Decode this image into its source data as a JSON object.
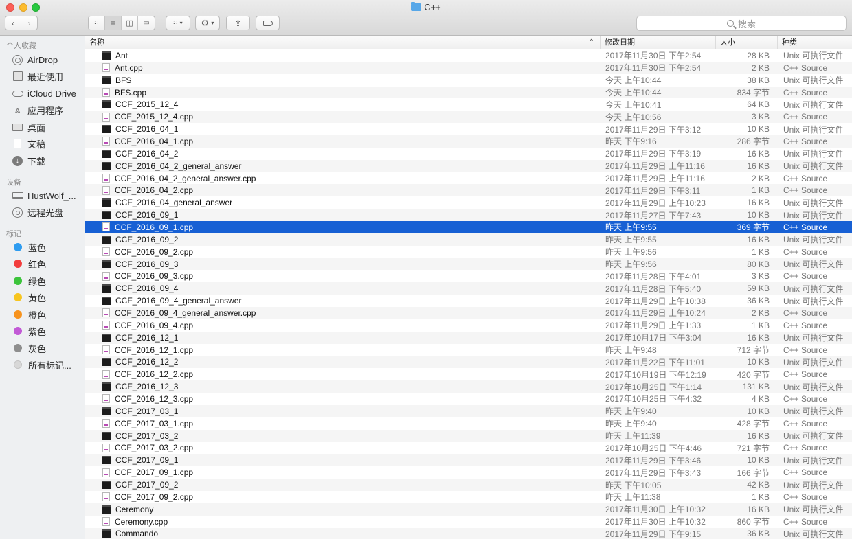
{
  "window": {
    "title": "C++"
  },
  "toolbar": {
    "search_placeholder": "搜索"
  },
  "sidebar": {
    "favorites_heading": "个人收藏",
    "favorites": [
      {
        "label": "AirDrop",
        "icon": "airdrop-icon"
      },
      {
        "label": "最近使用",
        "icon": "recents-icon"
      },
      {
        "label": "iCloud Drive",
        "icon": "cloud-icon"
      },
      {
        "label": "应用程序",
        "icon": "applications-icon"
      },
      {
        "label": "桌面",
        "icon": "desktop-icon"
      },
      {
        "label": "文稿",
        "icon": "documents-icon"
      },
      {
        "label": "下载",
        "icon": "downloads-icon"
      }
    ],
    "devices_heading": "设备",
    "devices": [
      {
        "label": "HustWolf_...",
        "icon": "laptop-icon"
      },
      {
        "label": "远程光盘",
        "icon": "disc-icon"
      }
    ],
    "tags_heading": "标记",
    "tags": [
      {
        "label": "蓝色",
        "color": "#2e9cf0"
      },
      {
        "label": "红色",
        "color": "#f23d3d"
      },
      {
        "label": "绿色",
        "color": "#3cc43c"
      },
      {
        "label": "黄色",
        "color": "#f7c520"
      },
      {
        "label": "橙色",
        "color": "#f7931e"
      },
      {
        "label": "紫色",
        "color": "#c25ad6"
      },
      {
        "label": "灰色",
        "color": "#8e8e8e"
      },
      {
        "label": "所有标记...",
        "color": "#d8d8d8"
      }
    ]
  },
  "columns": {
    "name": "名称",
    "date": "修改日期",
    "size": "大小",
    "kind": "种类"
  },
  "colors": {
    "selection": "#1760d4"
  },
  "files": [
    {
      "name": "Ant",
      "date": "2017年11月30日 下午2:54",
      "size": "28 KB",
      "kind": "Unix 可执行文件",
      "type": "exec"
    },
    {
      "name": "Ant.cpp",
      "date": "2017年11月30日 下午2:54",
      "size": "2 KB",
      "kind": "C++ Source",
      "type": "cpp"
    },
    {
      "name": "BFS",
      "date": "今天 上午10:44",
      "size": "38 KB",
      "kind": "Unix 可执行文件",
      "type": "exec"
    },
    {
      "name": "BFS.cpp",
      "date": "今天 上午10:44",
      "size": "834 字节",
      "kind": "C++ Source",
      "type": "cpp"
    },
    {
      "name": "CCF_2015_12_4",
      "date": "今天 上午10:41",
      "size": "64 KB",
      "kind": "Unix 可执行文件",
      "type": "exec"
    },
    {
      "name": "CCF_2015_12_4.cpp",
      "date": "今天 上午10:56",
      "size": "3 KB",
      "kind": "C++ Source",
      "type": "cpp"
    },
    {
      "name": "CCF_2016_04_1",
      "date": "2017年11月29日 下午3:12",
      "size": "10 KB",
      "kind": "Unix 可执行文件",
      "type": "exec"
    },
    {
      "name": "CCF_2016_04_1.cpp",
      "date": "昨天 下午9:16",
      "size": "286 字节",
      "kind": "C++ Source",
      "type": "cpp"
    },
    {
      "name": "CCF_2016_04_2",
      "date": "2017年11月29日 下午3:19",
      "size": "16 KB",
      "kind": "Unix 可执行文件",
      "type": "exec"
    },
    {
      "name": "CCF_2016_04_2_general_answer",
      "date": "2017年11月29日 上午11:16",
      "size": "16 KB",
      "kind": "Unix 可执行文件",
      "type": "exec"
    },
    {
      "name": "CCF_2016_04_2_general_answer.cpp",
      "date": "2017年11月29日 上午11:16",
      "size": "2 KB",
      "kind": "C++ Source",
      "type": "cpp"
    },
    {
      "name": "CCF_2016_04_2.cpp",
      "date": "2017年11月29日 下午3:11",
      "size": "1 KB",
      "kind": "C++ Source",
      "type": "cpp"
    },
    {
      "name": "CCF_2016_04_general_answer",
      "date": "2017年11月29日 上午10:23",
      "size": "16 KB",
      "kind": "Unix 可执行文件",
      "type": "exec"
    },
    {
      "name": "CCF_2016_09_1",
      "date": "2017年11月27日 下午7:43",
      "size": "10 KB",
      "kind": "Unix 可执行文件",
      "type": "exec"
    },
    {
      "name": "CCF_2016_09_1.cpp",
      "date": "昨天 上午9:55",
      "size": "369 字节",
      "kind": "C++ Source",
      "type": "cpp",
      "selected": true
    },
    {
      "name": "CCF_2016_09_2",
      "date": "昨天 上午9:55",
      "size": "16 KB",
      "kind": "Unix 可执行文件",
      "type": "exec"
    },
    {
      "name": "CCF_2016_09_2.cpp",
      "date": "昨天 上午9:56",
      "size": "1 KB",
      "kind": "C++ Source",
      "type": "cpp"
    },
    {
      "name": "CCF_2016_09_3",
      "date": "昨天 上午9:56",
      "size": "80 KB",
      "kind": "Unix 可执行文件",
      "type": "exec"
    },
    {
      "name": "CCF_2016_09_3.cpp",
      "date": "2017年11月28日 下午4:01",
      "size": "3 KB",
      "kind": "C++ Source",
      "type": "cpp"
    },
    {
      "name": "CCF_2016_09_4",
      "date": "2017年11月28日 下午5:40",
      "size": "59 KB",
      "kind": "Unix 可执行文件",
      "type": "exec"
    },
    {
      "name": "CCF_2016_09_4_general_answer",
      "date": "2017年11月29日 上午10:38",
      "size": "36 KB",
      "kind": "Unix 可执行文件",
      "type": "exec"
    },
    {
      "name": "CCF_2016_09_4_general_answer.cpp",
      "date": "2017年11月29日 上午10:24",
      "size": "2 KB",
      "kind": "C++ Source",
      "type": "cpp"
    },
    {
      "name": "CCF_2016_09_4.cpp",
      "date": "2017年11月29日 上午1:33",
      "size": "1 KB",
      "kind": "C++ Source",
      "type": "cpp"
    },
    {
      "name": "CCF_2016_12_1",
      "date": "2017年10月17日 下午3:04",
      "size": "16 KB",
      "kind": "Unix 可执行文件",
      "type": "exec"
    },
    {
      "name": "CCF_2016_12_1.cpp",
      "date": "昨天 上午9:48",
      "size": "712 字节",
      "kind": "C++ Source",
      "type": "cpp"
    },
    {
      "name": "CCF_2016_12_2",
      "date": "2017年11月22日 下午11:01",
      "size": "10 KB",
      "kind": "Unix 可执行文件",
      "type": "exec"
    },
    {
      "name": "CCF_2016_12_2.cpp",
      "date": "2017年10月19日 下午12:19",
      "size": "420 字节",
      "kind": "C++ Source",
      "type": "cpp"
    },
    {
      "name": "CCF_2016_12_3",
      "date": "2017年10月25日 下午1:14",
      "size": "131 KB",
      "kind": "Unix 可执行文件",
      "type": "exec"
    },
    {
      "name": "CCF_2016_12_3.cpp",
      "date": "2017年10月25日 下午4:32",
      "size": "4 KB",
      "kind": "C++ Source",
      "type": "cpp"
    },
    {
      "name": "CCF_2017_03_1",
      "date": "昨天 上午9:40",
      "size": "10 KB",
      "kind": "Unix 可执行文件",
      "type": "exec"
    },
    {
      "name": "CCF_2017_03_1.cpp",
      "date": "昨天 上午9:40",
      "size": "428 字节",
      "kind": "C++ Source",
      "type": "cpp"
    },
    {
      "name": "CCF_2017_03_2",
      "date": "昨天 上午11:39",
      "size": "16 KB",
      "kind": "Unix 可执行文件",
      "type": "exec"
    },
    {
      "name": "CCF_2017_03_2.cpp",
      "date": "2017年10月25日 下午4:46",
      "size": "721 字节",
      "kind": "C++ Source",
      "type": "cpp"
    },
    {
      "name": "CCF_2017_09_1",
      "date": "2017年11月29日 下午3:46",
      "size": "10 KB",
      "kind": "Unix 可执行文件",
      "type": "exec"
    },
    {
      "name": "CCF_2017_09_1.cpp",
      "date": "2017年11月29日 下午3:43",
      "size": "166 字节",
      "kind": "C++ Source",
      "type": "cpp"
    },
    {
      "name": "CCF_2017_09_2",
      "date": "昨天 下午10:05",
      "size": "42 KB",
      "kind": "Unix 可执行文件",
      "type": "exec"
    },
    {
      "name": "CCF_2017_09_2.cpp",
      "date": "昨天 上午11:38",
      "size": "1 KB",
      "kind": "C++ Source",
      "type": "cpp"
    },
    {
      "name": "Ceremony",
      "date": "2017年11月30日 上午10:32",
      "size": "16 KB",
      "kind": "Unix 可执行文件",
      "type": "exec"
    },
    {
      "name": "Ceremony.cpp",
      "date": "2017年11月30日 上午10:32",
      "size": "860 字节",
      "kind": "C++ Source",
      "type": "cpp"
    },
    {
      "name": "Commando",
      "date": "2017年11月29日 下午9:15",
      "size": "36 KB",
      "kind": "Unix 可执行文件",
      "type": "exec"
    }
  ]
}
